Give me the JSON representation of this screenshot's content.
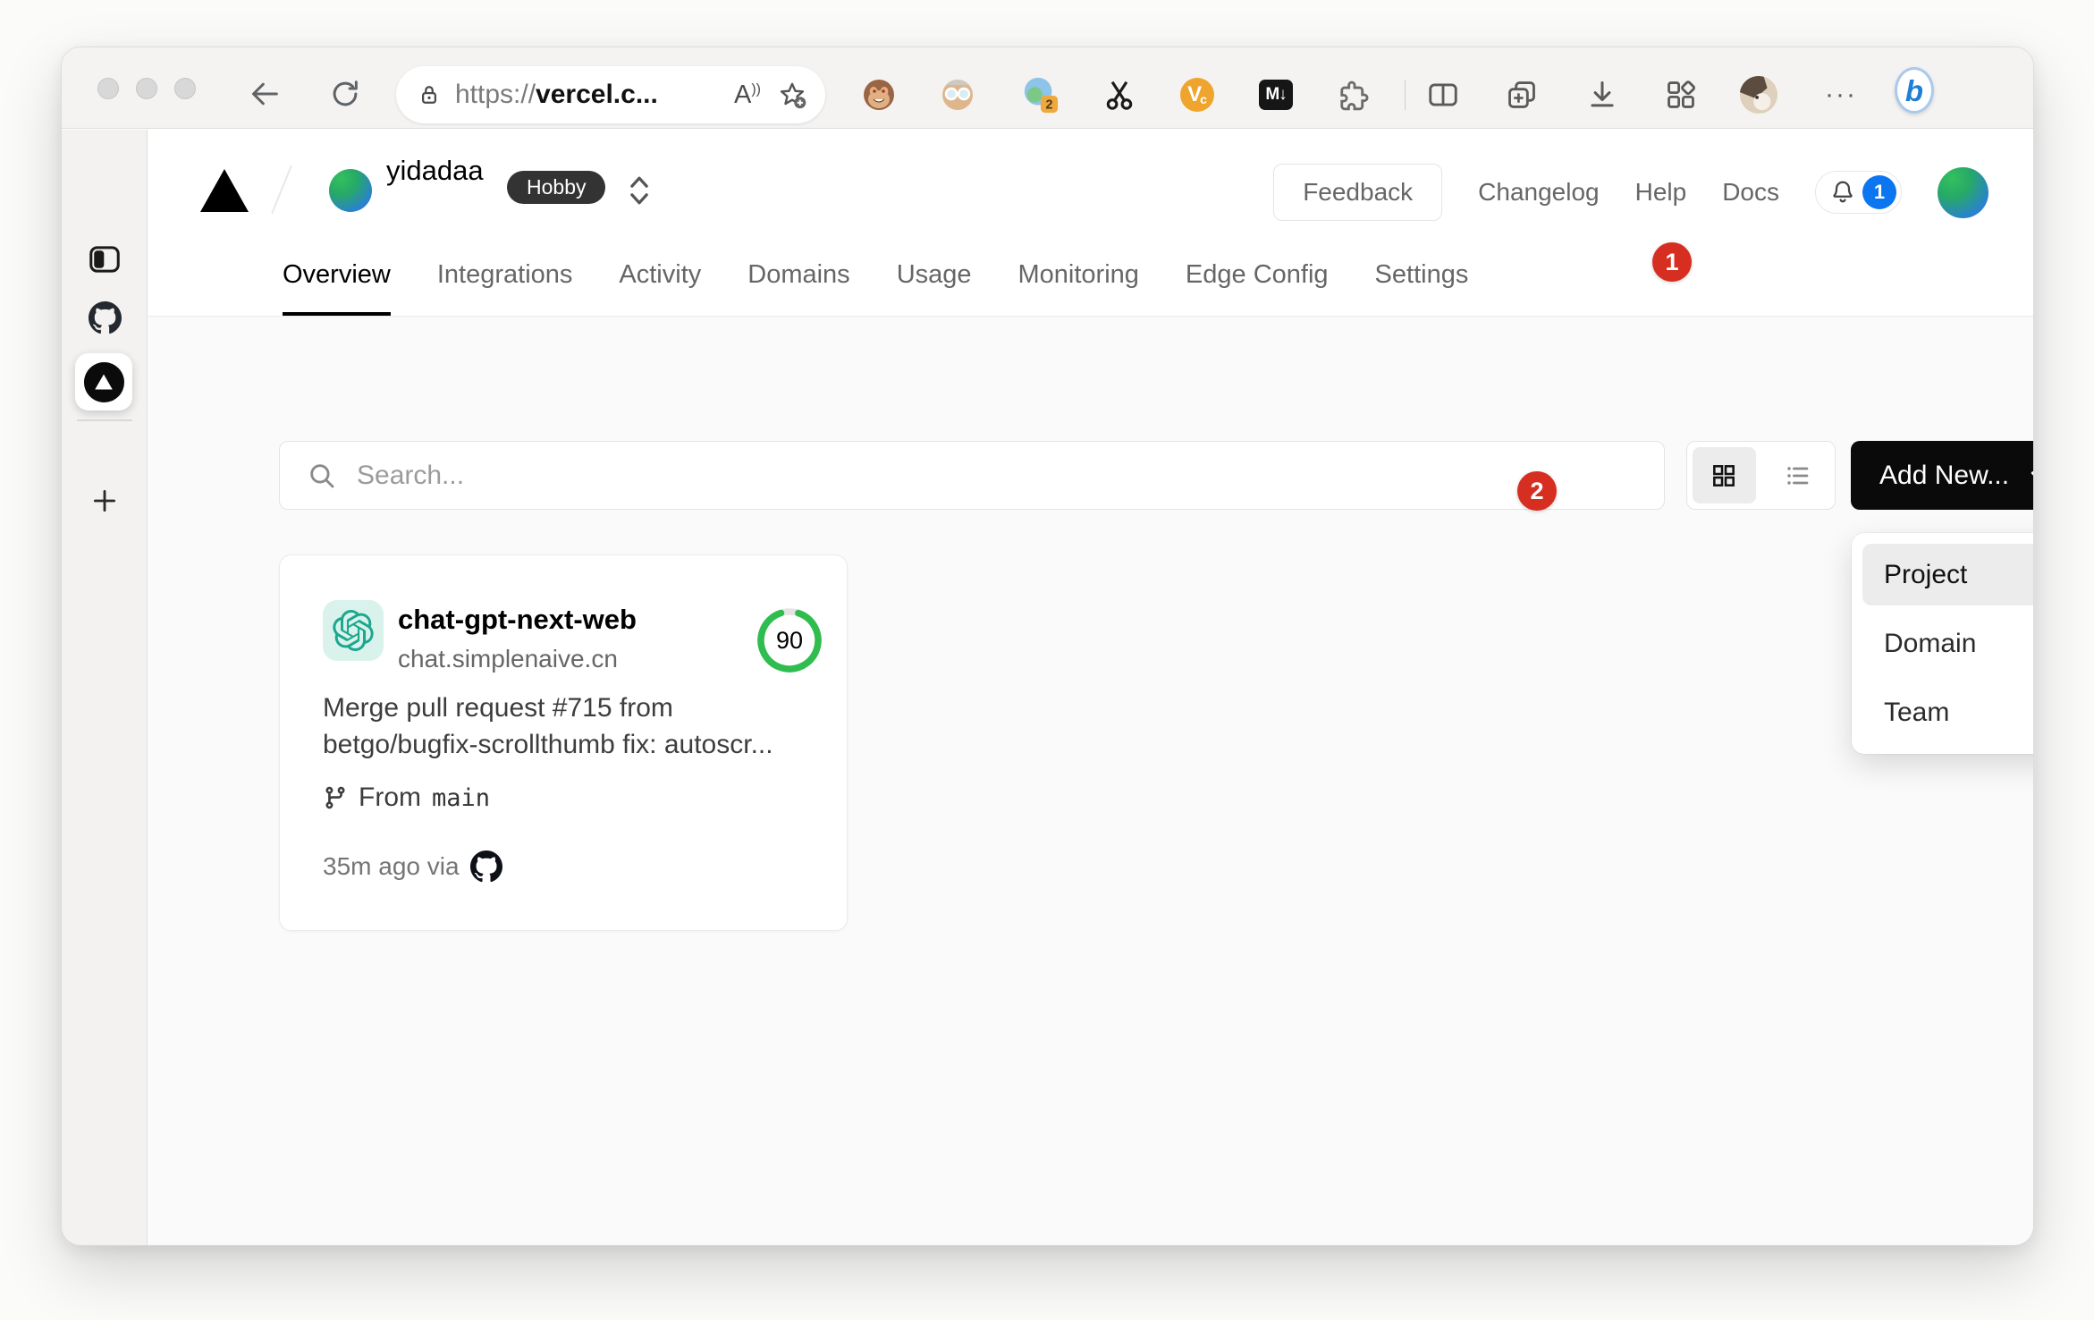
{
  "browser": {
    "url": {
      "scheme": "https://",
      "host": "vercel.c..."
    },
    "read_aloud_label": "A",
    "extensions": {
      "translate_badge": "2",
      "vc_letter": "V",
      "vc_sub": "c",
      "markdown_label": "M↓"
    },
    "more_label": "···",
    "bing_label": "b"
  },
  "vercel": {
    "team": {
      "name": "yidadaa",
      "plan": "Hobby"
    },
    "nav": {
      "feedback": "Feedback",
      "changelog": "Changelog",
      "help": "Help",
      "docs": "Docs",
      "notification_count": "1"
    },
    "tabs": {
      "items": [
        "Overview",
        "Integrations",
        "Activity",
        "Domains",
        "Usage",
        "Monitoring",
        "Edge Config",
        "Settings"
      ],
      "active": "Overview"
    },
    "toolbar": {
      "search_placeholder": "Search...",
      "add_new_label": "Add New..."
    },
    "add_new_menu": {
      "items": [
        "Project",
        "Domain",
        "Team"
      ],
      "highlighted": "Project"
    },
    "project": {
      "name": "chat-gpt-next-web",
      "domain": "chat.simplenaive.cn",
      "score": "90",
      "commit_line1": "Merge pull request #715 from",
      "commit_line2": "betgo/bugfix-scrollthumb fix: autoscr...",
      "from_label": "From",
      "branch": "main",
      "meta": "35m ago via"
    }
  },
  "annotations": {
    "step1": "1",
    "step2": "2"
  },
  "colors": {
    "annotation_red": "#d62e20",
    "score_green": "#2ebd4e",
    "notification_blue": "#0b76ef",
    "openai_teal": "#1ca78f",
    "button_black": "#0a0a0a"
  }
}
